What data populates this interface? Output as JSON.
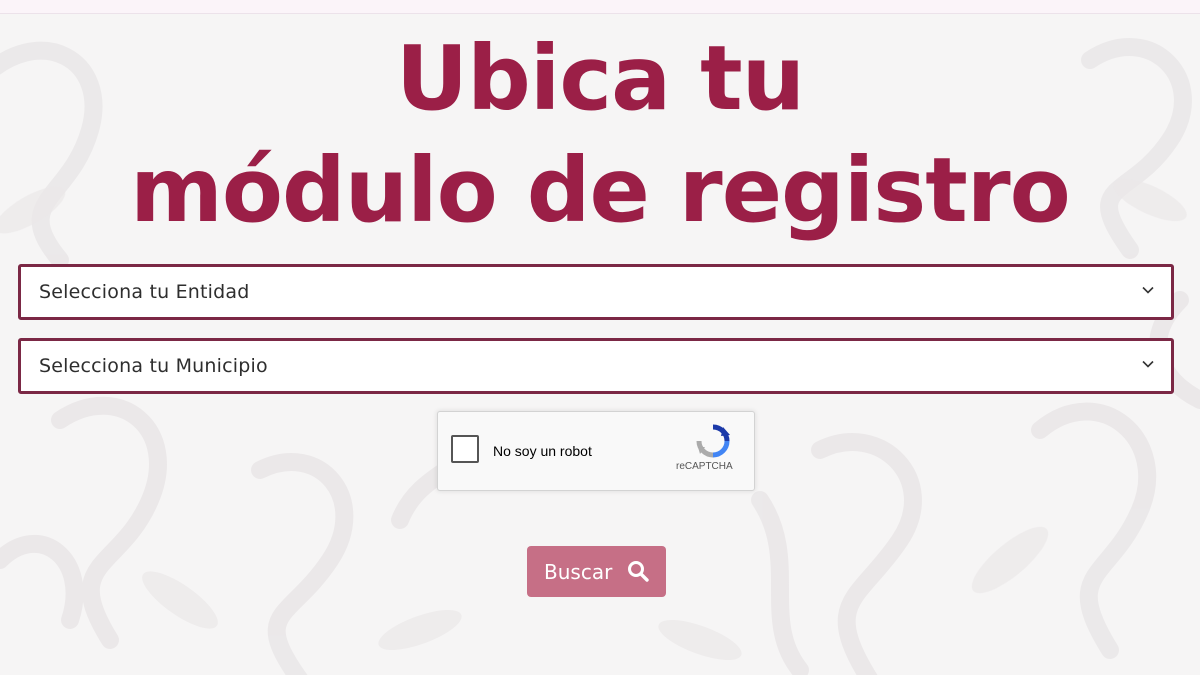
{
  "page": {
    "title_line1": "Ubica tu",
    "title_line2": "módulo de registro"
  },
  "form": {
    "entidad_select": {
      "selected": "Selecciona tu Entidad"
    },
    "municipio_select": {
      "selected": "Selecciona tu Municipio"
    },
    "recaptcha": {
      "label": "No soy un robot",
      "brand": "reCAPTCHA"
    },
    "search_button": {
      "label": "Buscar",
      "icon": "search-icon"
    }
  },
  "colors": {
    "title": "#9b1f47",
    "select_border": "#7b2845",
    "button_bg": "#c66f86",
    "background": "#f6f5f5"
  }
}
